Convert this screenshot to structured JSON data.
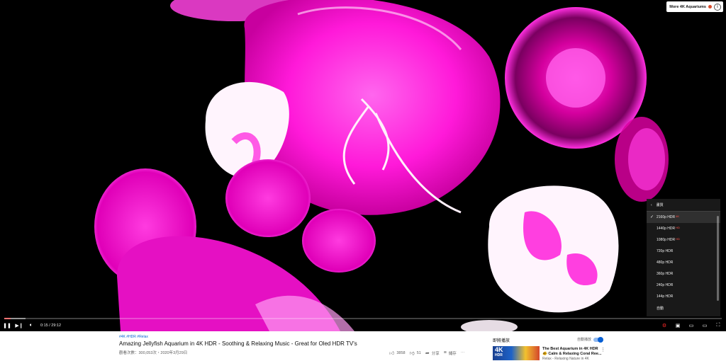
{
  "player": {
    "info_card": {
      "label": "More 4K Aquariums",
      "icon": "info-icon"
    },
    "settings_menu": {
      "header_label": "畫質",
      "items": [
        {
          "label": "2160p HDR",
          "hd_badge": "4K",
          "selected": true
        },
        {
          "label": "1440p HDR",
          "hd_badge": "HD",
          "selected": false
        },
        {
          "label": "1080p HDR",
          "hd_badge": "HD",
          "selected": false
        },
        {
          "label": "720p HDR",
          "hd_badge": "",
          "selected": false
        },
        {
          "label": "480p HDR",
          "hd_badge": "",
          "selected": false
        },
        {
          "label": "360p HDR",
          "hd_badge": "",
          "selected": false
        },
        {
          "label": "240p HDR",
          "hd_badge": "",
          "selected": false
        },
        {
          "label": "144p HDR",
          "hd_badge": "",
          "selected": false
        },
        {
          "label": "自動",
          "hd_badge": "",
          "selected": false
        }
      ]
    },
    "controls": {
      "time_display": "0:15 / 29:12",
      "progress_fraction": 0.009,
      "loaded_fraction": 0.03
    }
  },
  "video": {
    "hashtags": "#4K #HDR #Relax",
    "title": "Amazing Jellyfish Aquarium in 4K HDR - Soothing & Relaxing Music - Great for Oled HDR TV's",
    "meta": "觀看次數：300,053次・2020年3月29日",
    "likes": "3858",
    "dislikes": "51",
    "share_label": "分享",
    "save_label": "儲存",
    "more_label": "⋯"
  },
  "sidebar": {
    "up_next_label": "即將播放",
    "autoplay_label": "自動播放",
    "recommended": {
      "thumb_badge": "4K",
      "thumb_badge2": "HDR",
      "title": "The Best Aquarium in 4K HDR 🐠 Calm & Relaxing Coral Ree...",
      "channel": "Relax - Relaxing Nature in 4K"
    }
  },
  "colors": {
    "accent_red": "#ff0000",
    "link_blue": "#065fd4",
    "jellyfish_magenta": "#ff1fd6"
  }
}
